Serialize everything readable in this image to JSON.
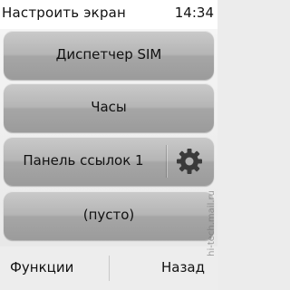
{
  "status_bar": {
    "title": "Настроить экран",
    "time": "14:34"
  },
  "items": [
    {
      "label": "Диспетчер SIM",
      "has_settings": false
    },
    {
      "label": "Часы",
      "has_settings": false
    },
    {
      "label": "Панель ссылок 1",
      "has_settings": true,
      "settings_icon": "gear-icon"
    },
    {
      "label": "(пусто)",
      "has_settings": false
    }
  ],
  "softkeys": {
    "left": "Функции",
    "right": "Назад"
  },
  "watermark": "hi-tech.mail.ru"
}
